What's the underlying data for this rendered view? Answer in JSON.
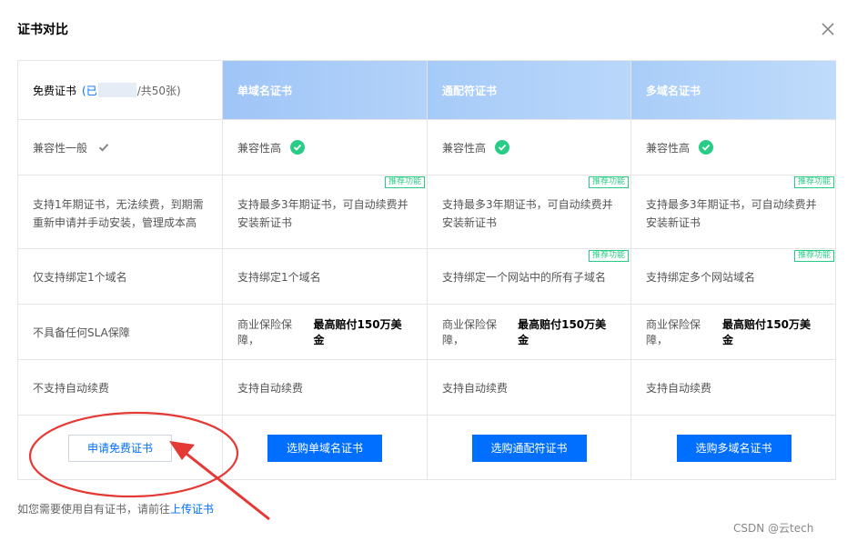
{
  "dialog": {
    "title": "证书对比"
  },
  "columns": [
    {
      "header_label": "免费证书",
      "quota_prefix": "(已",
      "quota_suffix": "/共50张)",
      "compat": "兼容性一般",
      "renew_desc": "支持1年期证书，无法续费，到期需重新申请并手动安装，管理成本高",
      "domain_desc": "仅支持绑定1个域名",
      "sla": "不具备任何SLA保障",
      "auto_renew": "不支持自动续费",
      "action": "申请免费证书"
    },
    {
      "header_label": "单域名证书",
      "compat": "兼容性高",
      "renew_desc": "支持最多3年期证书，可自动续费并安装新证书",
      "renew_badge": "推荐功能",
      "domain_desc": "支持绑定1个域名",
      "sla_prefix": "商业保险保障，",
      "sla_strong": "最高赔付150万美金",
      "auto_renew": "支持自动续费",
      "action": "选购单域名证书"
    },
    {
      "header_label": "通配符证书",
      "compat": "兼容性高",
      "renew_desc": "支持最多3年期证书，可自动续费并安装新证书",
      "renew_badge": "推荐功能",
      "domain_desc": "支持绑定一个网站中的所有子域名",
      "domain_badge": "推荐功能",
      "sla_prefix": "商业保险保障，",
      "sla_strong": "最高赔付150万美金",
      "auto_renew": "支持自动续费",
      "action": "选购通配符证书"
    },
    {
      "header_label": "多域名证书",
      "compat": "兼容性高",
      "renew_desc": "支持最多3年期证书，可自动续费并安装新证书",
      "renew_badge": "推荐功能",
      "domain_desc": "支持绑定多个网站域名",
      "domain_badge": "推荐功能",
      "sla_prefix": "商业保险保障，",
      "sla_strong": "最高赔付150万美金",
      "auto_renew": "支持自动续费",
      "action": "选购多域名证书"
    }
  ],
  "footer": {
    "note_prefix": "如您需要使用自有证书，请前往",
    "link": "上传证书"
  },
  "watermark": "CSDN @云tech",
  "colors": {
    "primary": "#006eff",
    "success": "#29cc85",
    "annotation": "#e53935"
  },
  "icons": [
    "close-icon",
    "check-icon",
    "check-circle-icon",
    "red-ellipse-annotation",
    "red-arrow-annotation"
  ]
}
